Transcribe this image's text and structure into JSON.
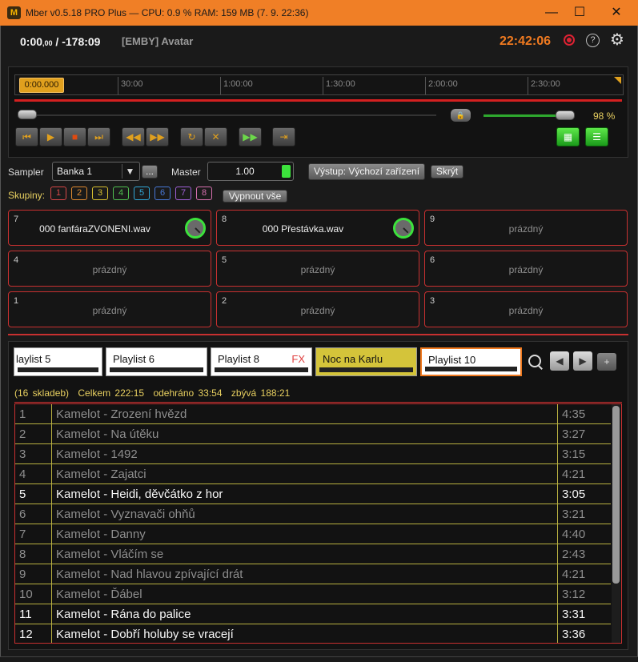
{
  "window": {
    "title": "Mber v0.5.18 PRO Plus  —  CPU: 0.9 %   RAM: 159 MB  (7. 9. 22:36)",
    "minimize": "—",
    "maximize": "☐",
    "close": "✕",
    "logo": "M"
  },
  "header": {
    "position_main": "0:00",
    "position_frac": ",00",
    "remaining": " / -178:09",
    "track": "[EMBY] Avatar",
    "clock": "22:42:06"
  },
  "timeline": {
    "cursor": "0:00.000",
    "ticks": [
      "30:00",
      "1:00:00",
      "1:30:00",
      "2:00:00",
      "2:30:00"
    ]
  },
  "volume": {
    "label": "98 %",
    "level": 0.98
  },
  "transport": {
    "prev": "⏮",
    "play": "▶",
    "stop": "■",
    "next": "⏭",
    "rewind": "◀◀",
    "forward": "▶▶",
    "repeat": "↻",
    "shuffle": "✕",
    "autoplay": "▶▶",
    "jump": "⇥",
    "grid_view": "▦",
    "list_view": "☰"
  },
  "sampler": {
    "label": "Sampler",
    "bank": "Banka 1",
    "more": "...",
    "master_label": "Master",
    "master_value": "1.00",
    "output_button": "Výstup: Výchozí zařízení",
    "hide_button": "Skrýt",
    "groups_label": "Skupiny:",
    "groups": [
      "1",
      "2",
      "3",
      "4",
      "5",
      "6",
      "7",
      "8"
    ],
    "all_off_button": "Vypnout vše"
  },
  "pads": [
    {
      "num": "7",
      "name": "000 fanfáraZVONENI.wav"
    },
    {
      "num": "8",
      "name": "000 Přestávka.wav"
    },
    {
      "num": "9",
      "name": "prázdný"
    },
    {
      "num": "4",
      "name": "prázdný"
    },
    {
      "num": "5",
      "name": "prázdný"
    },
    {
      "num": "6",
      "name": "prázdný"
    },
    {
      "num": "1",
      "name": "prázdný"
    },
    {
      "num": "2",
      "name": "prázdný"
    },
    {
      "num": "3",
      "name": "prázdný"
    }
  ],
  "playlists": {
    "tabs": [
      "laylist 5",
      "Playlist 6",
      "Playlist 8",
      "Noc na Karlu",
      "Playlist 10"
    ],
    "fx": "FX",
    "prev": "◀",
    "next": "▶",
    "add": "+"
  },
  "stats": {
    "count": "(16 skladeb)",
    "total": "Celkem 222:15",
    "played": "odehráno 33:54",
    "left": "zbývá 188:21"
  },
  "tracks": [
    {
      "n": "1",
      "title": "Kamelot - Zrození hvězd",
      "dur": "4:35"
    },
    {
      "n": "2",
      "title": "Kamelot - Na útěku",
      "dur": "3:27"
    },
    {
      "n": "3",
      "title": "Kamelot - 1492",
      "dur": "3:15"
    },
    {
      "n": "4",
      "title": "Kamelot - Zajatci",
      "dur": "4:21"
    },
    {
      "n": "5",
      "title": "Kamelot - Heidi, děvčátko z hor",
      "dur": "3:05"
    },
    {
      "n": "6",
      "title": "Kamelot - Vyznavači ohňů",
      "dur": "3:21"
    },
    {
      "n": "7",
      "title": "Kamelot - Danny",
      "dur": "4:40"
    },
    {
      "n": "8",
      "title": "Kamelot - Vláčím se",
      "dur": "2:43"
    },
    {
      "n": "9",
      "title": "Kamelot - Nad hlavou zpívající drát",
      "dur": "4:21"
    },
    {
      "n": "10",
      "title": "Kamelot - Ďábel",
      "dur": "3:12"
    },
    {
      "n": "11",
      "title": "Kamelot - Rána do palice",
      "dur": "3:31"
    },
    {
      "n": "12",
      "title": "Kamelot - Dobří holuby se vracejí",
      "dur": "3:36"
    }
  ],
  "colors": {
    "accent": "#f07f26",
    "alert": "#c83030",
    "active_green": "#3ce23c",
    "stats_yellow": "#e8d060",
    "group_colors": [
      "#d84848",
      "#e08a30",
      "#d8c030",
      "#50c050",
      "#30a8d8",
      "#4878d8",
      "#a060d8",
      "#d870b0"
    ]
  }
}
